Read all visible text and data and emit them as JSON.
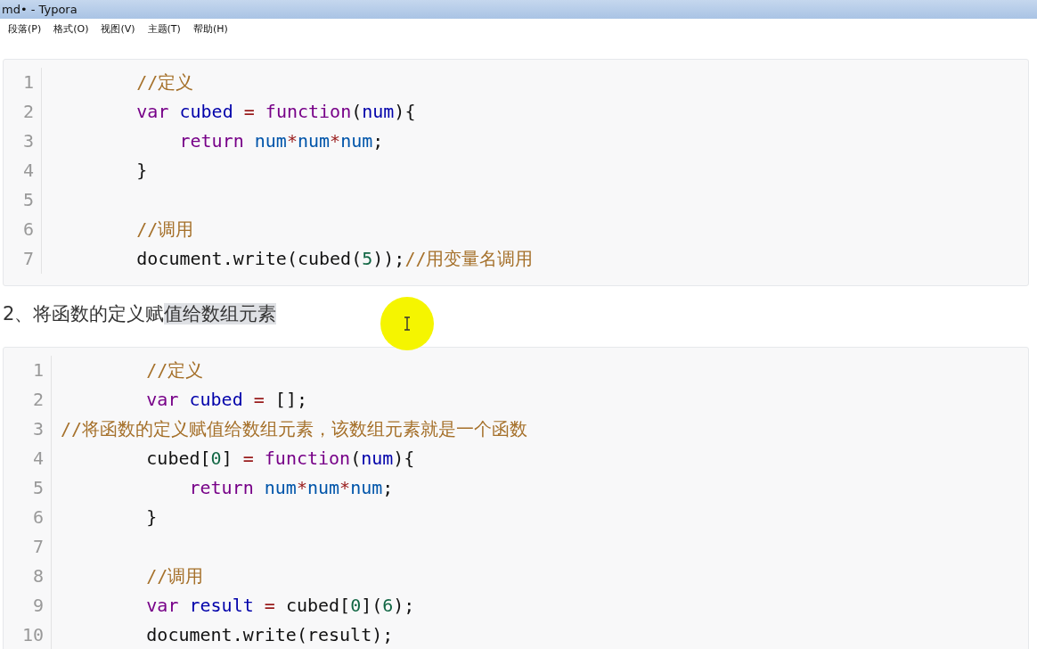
{
  "window": {
    "title": "md• - Typora"
  },
  "menu": [
    {
      "label": "段落(P)"
    },
    {
      "label": "格式(O)"
    },
    {
      "label": "视图(V)"
    },
    {
      "label": "主题(T)"
    },
    {
      "label": "帮助(H)"
    }
  ],
  "code_block_1": {
    "lines": [
      {
        "number": "1",
        "kind": "body",
        "tokens": [
          {
            "kind": "comment",
            "text": "//定义"
          }
        ]
      },
      {
        "number": "2",
        "kind": "body",
        "tokens": [
          {
            "kind": "keyword",
            "text": "var "
          },
          {
            "kind": "def",
            "text": "cubed "
          },
          {
            "kind": "operator",
            "text": "= "
          },
          {
            "kind": "keyword",
            "text": "function"
          },
          {
            "kind": "plain",
            "text": "("
          },
          {
            "kind": "def",
            "text": "num"
          },
          {
            "kind": "plain",
            "text": "){"
          }
        ]
      },
      {
        "number": "3",
        "kind": "nested",
        "tokens": [
          {
            "kind": "keyword",
            "text": "return "
          },
          {
            "kind": "variable",
            "text": "num"
          },
          {
            "kind": "operator",
            "text": "*"
          },
          {
            "kind": "variable",
            "text": "num"
          },
          {
            "kind": "operator",
            "text": "*"
          },
          {
            "kind": "variable",
            "text": "num"
          },
          {
            "kind": "plain",
            "text": ";"
          }
        ]
      },
      {
        "number": "4",
        "kind": "body",
        "tokens": [
          {
            "kind": "plain",
            "text": "}"
          }
        ]
      },
      {
        "number": "5"
      },
      {
        "number": "6",
        "kind": "body",
        "tokens": [
          {
            "kind": "comment",
            "text": "//调用"
          }
        ]
      },
      {
        "number": "7",
        "kind": "body",
        "tokens": [
          {
            "kind": "plain",
            "text": "document.write(cubed("
          },
          {
            "kind": "number",
            "text": "5"
          },
          {
            "kind": "plain",
            "text": "));"
          },
          {
            "kind": "comment",
            "text": "//用变量名调用"
          }
        ]
      }
    ]
  },
  "heading": {
    "parts": [
      {
        "text": "2、将函数的定义赋",
        "selected": false
      },
      {
        "text": "值给数组元素",
        "selected": true
      }
    ]
  },
  "code_block_2": {
    "lines": [
      {
        "number": "1",
        "kind": "body",
        "tokens": [
          {
            "kind": "comment",
            "text": "//定义"
          }
        ]
      },
      {
        "number": "2",
        "kind": "body",
        "tokens": [
          {
            "kind": "keyword",
            "text": "var "
          },
          {
            "kind": "def",
            "text": "cubed "
          },
          {
            "kind": "operator",
            "text": "= "
          },
          {
            "kind": "plain",
            "text": "[];"
          }
        ]
      },
      {
        "number": "3",
        "kind": "none",
        "tokens": [
          {
            "kind": "comment",
            "text": "//将函数的定义赋值给数组元素，该数组元素就是一个函数"
          }
        ]
      },
      {
        "number": "4",
        "kind": "body",
        "tokens": [
          {
            "kind": "plain",
            "text": "cubed["
          },
          {
            "kind": "number",
            "text": "0"
          },
          {
            "kind": "plain",
            "text": "] "
          },
          {
            "kind": "operator",
            "text": "= "
          },
          {
            "kind": "keyword",
            "text": "function"
          },
          {
            "kind": "plain",
            "text": "("
          },
          {
            "kind": "def",
            "text": "num"
          },
          {
            "kind": "plain",
            "text": "){"
          }
        ]
      },
      {
        "number": "5",
        "kind": "nested",
        "tokens": [
          {
            "kind": "keyword",
            "text": "return "
          },
          {
            "kind": "variable",
            "text": "num"
          },
          {
            "kind": "operator",
            "text": "*"
          },
          {
            "kind": "variable",
            "text": "num"
          },
          {
            "kind": "operator",
            "text": "*"
          },
          {
            "kind": "variable",
            "text": "num"
          },
          {
            "kind": "plain",
            "text": ";"
          }
        ]
      },
      {
        "number": "6",
        "kind": "body",
        "tokens": [
          {
            "kind": "plain",
            "text": "}"
          }
        ]
      },
      {
        "number": "7"
      },
      {
        "number": "8",
        "kind": "body",
        "tokens": [
          {
            "kind": "comment",
            "text": "//调用"
          }
        ]
      },
      {
        "number": "9",
        "kind": "body",
        "tokens": [
          {
            "kind": "keyword",
            "text": "var "
          },
          {
            "kind": "def",
            "text": "result "
          },
          {
            "kind": "operator",
            "text": "= "
          },
          {
            "kind": "plain",
            "text": "cubed["
          },
          {
            "kind": "number",
            "text": "0"
          },
          {
            "kind": "plain",
            "text": "]("
          },
          {
            "kind": "number",
            "text": "6"
          },
          {
            "kind": "plain",
            "text": ");"
          }
        ]
      },
      {
        "number": "10",
        "kind": "body",
        "tokens": [
          {
            "kind": "plain",
            "text": "document.write(result);"
          }
        ]
      }
    ]
  }
}
